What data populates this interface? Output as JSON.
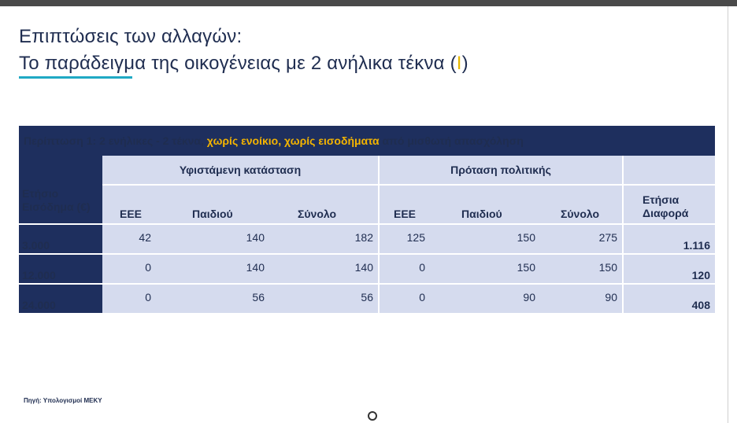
{
  "title": {
    "line1": "Επιπτώσεις των αλλαγών:",
    "line2_prefix": "Το παράδειγμα της οικογένειας με 2 ανήλικα τέκνα (",
    "line2_mark": "I",
    "line2_suffix": ")"
  },
  "table": {
    "caption_part1": "Περίπτωση 1: 2 ενήλικες - 2 τέκνα, ",
    "caption_highlight": "χωρίς ενοίκιο, χωρίς εισοδήματα",
    "caption_part2": " από μισθωτή απασχόληση",
    "group_current": "Υφιστάμενη κατάσταση",
    "group_proposal": "Πρόταση πολιτικής",
    "row_header": "Ετήσιο Εισόδημα (€)",
    "col_eee": "ΕΕΕ",
    "col_child": "Παιδιού",
    "col_total": "Σύνολο",
    "col_diff": "Ετήσια Διαφορά",
    "rows": [
      {
        "income": "3.000",
        "cur_eee": "42",
        "cur_child": "140",
        "cur_total": "182",
        "new_eee": "125",
        "new_child": "150",
        "new_total": "275",
        "diff": "1.116"
      },
      {
        "income": "12.000",
        "cur_eee": "0",
        "cur_child": "140",
        "cur_total": "140",
        "new_eee": "0",
        "new_child": "150",
        "new_total": "150",
        "diff": "120"
      },
      {
        "income": "24.000",
        "cur_eee": "0",
        "cur_child": "56",
        "cur_total": "56",
        "new_eee": "0",
        "new_child": "90",
        "new_total": "90",
        "diff": "408"
      }
    ]
  },
  "source": "Πηγή: Υπολογισμοί ΜΕΚΥ",
  "colors": {
    "navy": "#1e2f5e",
    "highlight": "#f4b400",
    "positive": "#1aa64b",
    "accent_line": "#1fa9c4"
  }
}
